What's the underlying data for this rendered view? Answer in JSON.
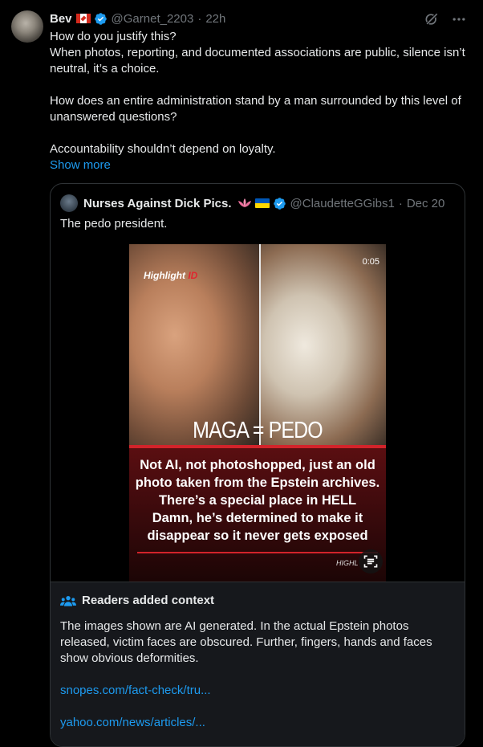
{
  "post": {
    "display_name": "Bev",
    "handle": "@Garnet_2203",
    "separator": "·",
    "time": "22h",
    "text_lines": [
      "How do you justify this?",
      "When photos, reporting, and documented associations are public, silence isn’t neutral, it’s a choice.",
      "",
      "How does an entire administration stand by a man surrounded by this level of unanswered questions?",
      "",
      "Accountability shouldn’t depend on loyalty."
    ],
    "show_more": "Show more",
    "icons": [
      "canada-flag-icon",
      "verified-badge-icon",
      "grok-icon",
      "more-icon"
    ]
  },
  "quote": {
    "display_name": "Nurses Against Dick Pics.",
    "handle": "@ClaudetteGGibs1",
    "separator": "·",
    "date": "Dec 20",
    "text": "The pedo president.",
    "media": {
      "logo_main": "Highlight",
      "logo_accent": "ID",
      "duration": "0:05",
      "headline": "MAGA = PEDO",
      "caption_lines": [
        "Not AI, not photoshopped, just an old",
        "photo taken from the Epstein archives.",
        "There’s a special place in HELL",
        "Damn, he’s determined to make it",
        "disappear so it never gets exposed"
      ],
      "watermark": "HIGHL"
    }
  },
  "context": {
    "title": "Readers added context",
    "body": "The images shown are AI generated. In the actual Epstein photos released, victim faces are obscured. Further, fingers, hands and faces show obvious deformities.",
    "links": [
      "snopes.com/fact-check/tru...",
      "yahoo.com/news/articles/..."
    ]
  },
  "colors": {
    "background": "#000000",
    "text": "#e7e9ea",
    "muted": "#71767b",
    "link": "#1d9bf0",
    "border": "#2f3336",
    "verified": "#1d9bf0"
  }
}
